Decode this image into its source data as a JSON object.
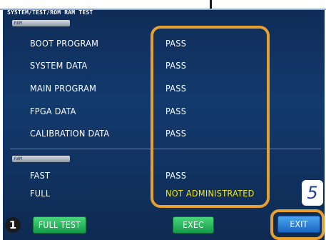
{
  "header": {
    "title": "SYSTEM/TEST/ROM RAM TEST"
  },
  "rom_section": {
    "label": "ROM",
    "rows": [
      {
        "name": "BOOT PROGRAM",
        "result": "PASS"
      },
      {
        "name": "SYSTEM DATA",
        "result": "PASS"
      },
      {
        "name": "MAIN PROGRAM",
        "result": "PASS"
      },
      {
        "name": "FPGA DATA",
        "result": "PASS"
      },
      {
        "name": "CALIBRATION DATA",
        "result": "PASS"
      }
    ]
  },
  "ram_section": {
    "label": "RAM",
    "rows": [
      {
        "name": "FAST",
        "result": "PASS"
      },
      {
        "name": "FULL",
        "result": "NOT ADMINISTRATED"
      }
    ]
  },
  "buttons": {
    "full_test": "FULL TEST",
    "exec": "EXEC",
    "exit": "EXIT"
  },
  "callouts": {
    "step_1": "1",
    "step_5": "5"
  },
  "colors": {
    "screen_bg": "#133a6d",
    "pass_text": "#ffffff",
    "warn_text": "#f5e61a",
    "highlight": "#e6a030",
    "green_button": "#159a49",
    "blue_button": "#1a66c4"
  }
}
